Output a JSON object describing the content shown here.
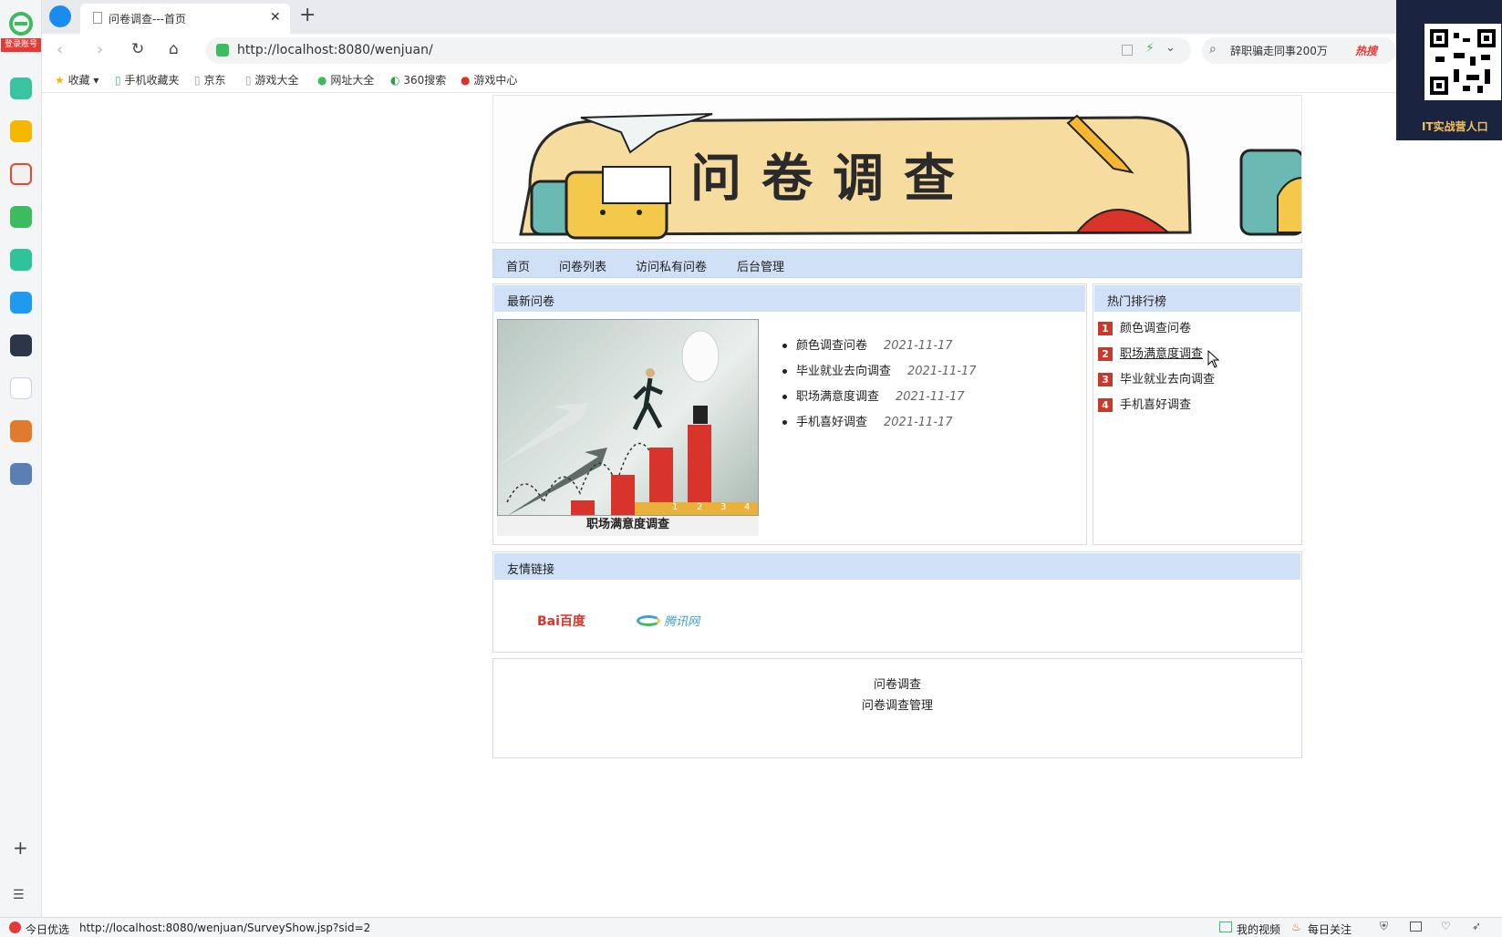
{
  "browser": {
    "login_badge": "登录账号",
    "tab_title": "问卷调查---首页",
    "url": "http://localhost:8080/wenjuan/",
    "search_text": "辞职骗走同事200万",
    "search_hot": "热搜",
    "qr_caption": "IT实战营人口",
    "favorites": [
      "收藏",
      "手机收藏夹",
      "京东",
      "游戏大全",
      "网址大全",
      "360搜索",
      "游戏中心"
    ],
    "status_left": "今日优选",
    "status_url": "http://localhost:8080/wenjuan/SurveyShow.jsp?sid=2",
    "status_video": "我的视频",
    "status_follow": "每日关注"
  },
  "banner": {
    "title": "问卷调查"
  },
  "nav": [
    "首页",
    "问卷列表",
    "访问私有问卷",
    "后台管理"
  ],
  "latest": {
    "header": "最新问卷",
    "image_caption": "职场满意度调查",
    "chart_numbers": [
      "1",
      "2",
      "3",
      "4"
    ],
    "items": [
      {
        "title": "颜色调查问卷",
        "date": "2021-11-17"
      },
      {
        "title": "毕业就业去向调查",
        "date": "2021-11-17"
      },
      {
        "title": "职场满意度调查",
        "date": "2021-11-17"
      },
      {
        "title": "手机喜好调查",
        "date": "2021-11-17"
      }
    ]
  },
  "ranking": {
    "header": "热门排行榜",
    "items": [
      {
        "rank": "1",
        "title": "颜色调查问卷"
      },
      {
        "rank": "2",
        "title": "职场满意度调查"
      },
      {
        "rank": "3",
        "title": "毕业就业去向调查"
      },
      {
        "rank": "4",
        "title": "手机喜好调查"
      }
    ]
  },
  "links": {
    "header": "友情链接",
    "baidu": "Bai百度",
    "tencent": "腾讯网"
  },
  "footer": {
    "line1": "问卷调查",
    "line2": "问卷调查管理"
  },
  "colors": {
    "header_bg": "#cfe0f7",
    "rank_badge": "#c8392b",
    "accent_green": "#3dbb5f"
  }
}
